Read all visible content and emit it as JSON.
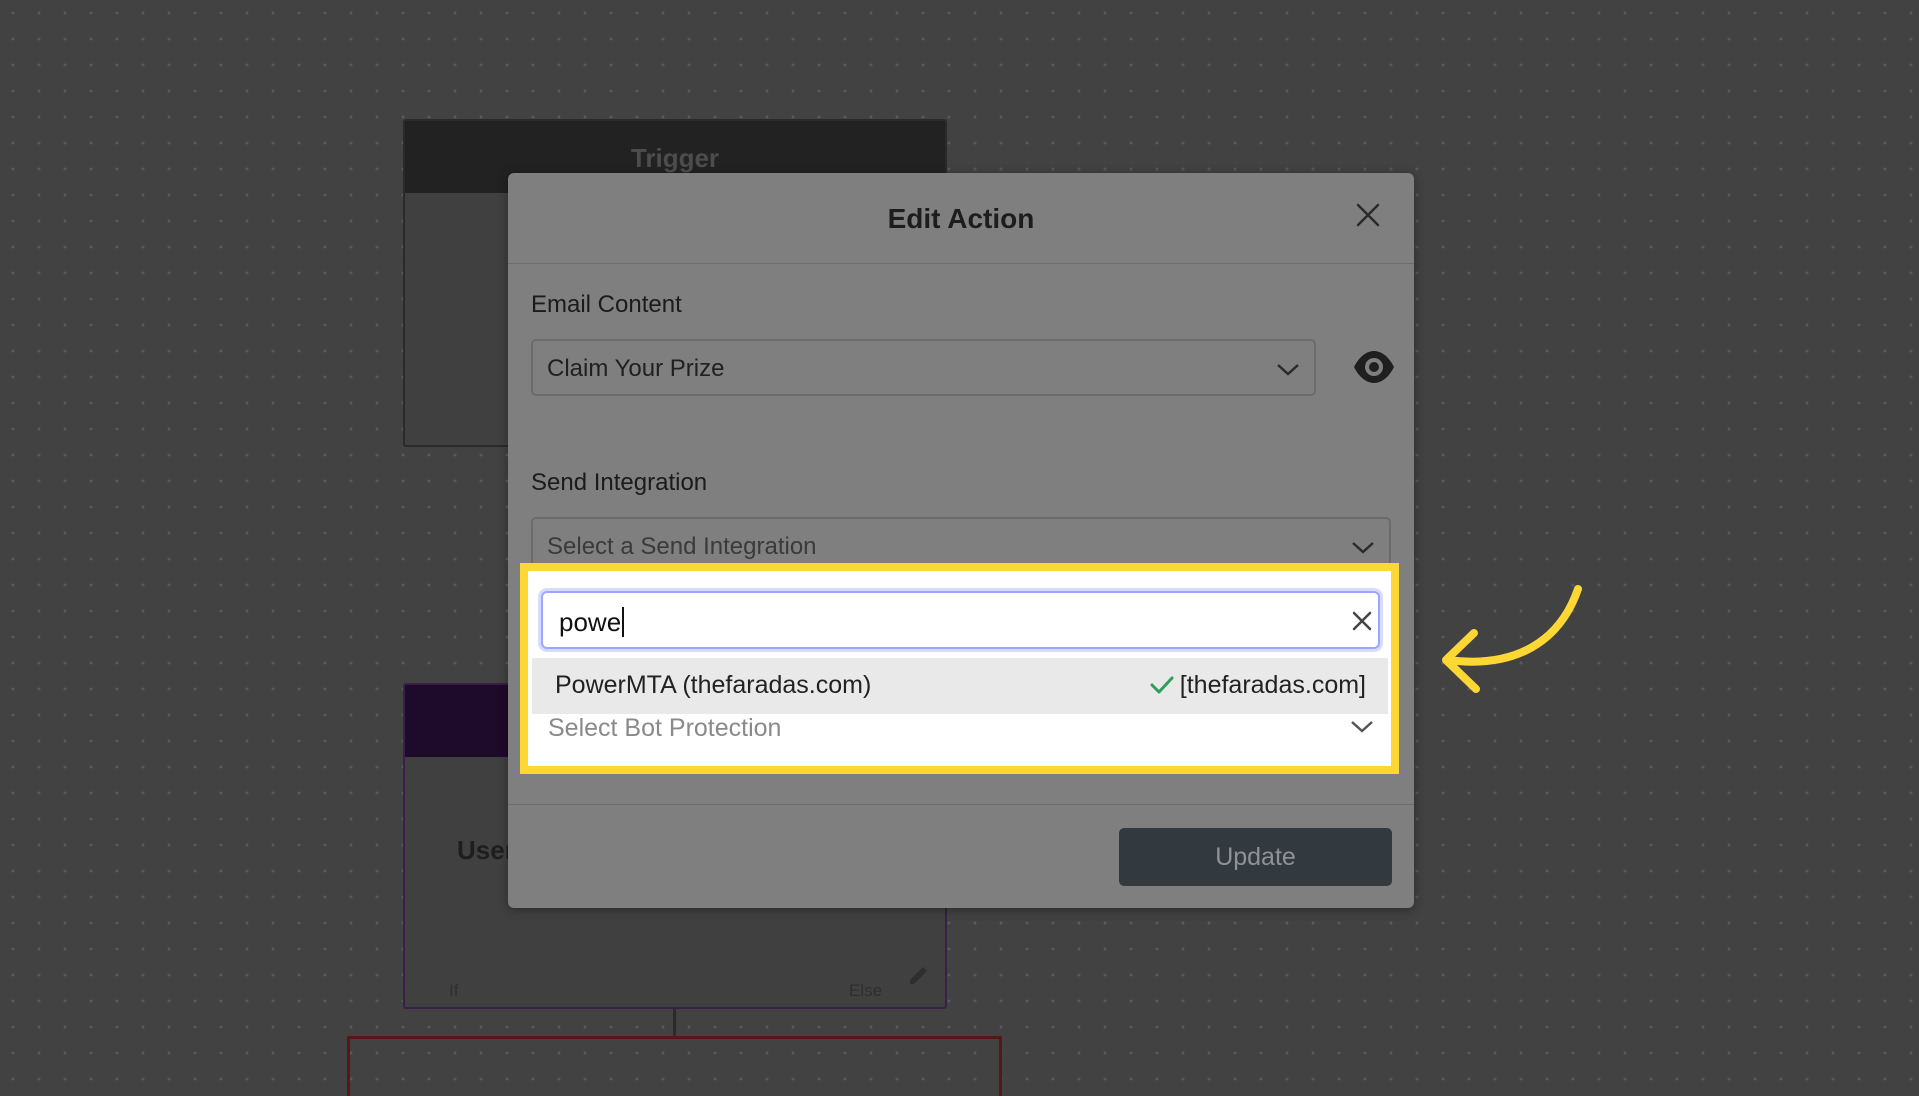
{
  "background": {
    "trigger_node_title": "Trigger",
    "condition_node_text": "User",
    "condition_if_label": "If",
    "condition_else_label": "Else"
  },
  "modal": {
    "title": "Edit Action",
    "email_content": {
      "label": "Email Content",
      "selected": "Claim Your Prize"
    },
    "send_integration": {
      "label": "Send Integration",
      "placeholder": "Select a Send Integration",
      "search_value": "powe",
      "options": [
        {
          "label": "PowerMTA (thefaradas.com)",
          "tag": "[thefaradas.com]"
        }
      ]
    },
    "bot_protection": {
      "placeholder": "Select Bot Protection"
    },
    "update_label": "Update"
  },
  "colors": {
    "highlight": "#fdd835",
    "check": "#2e9e5b",
    "focus_ring": "#9aa6ff"
  }
}
